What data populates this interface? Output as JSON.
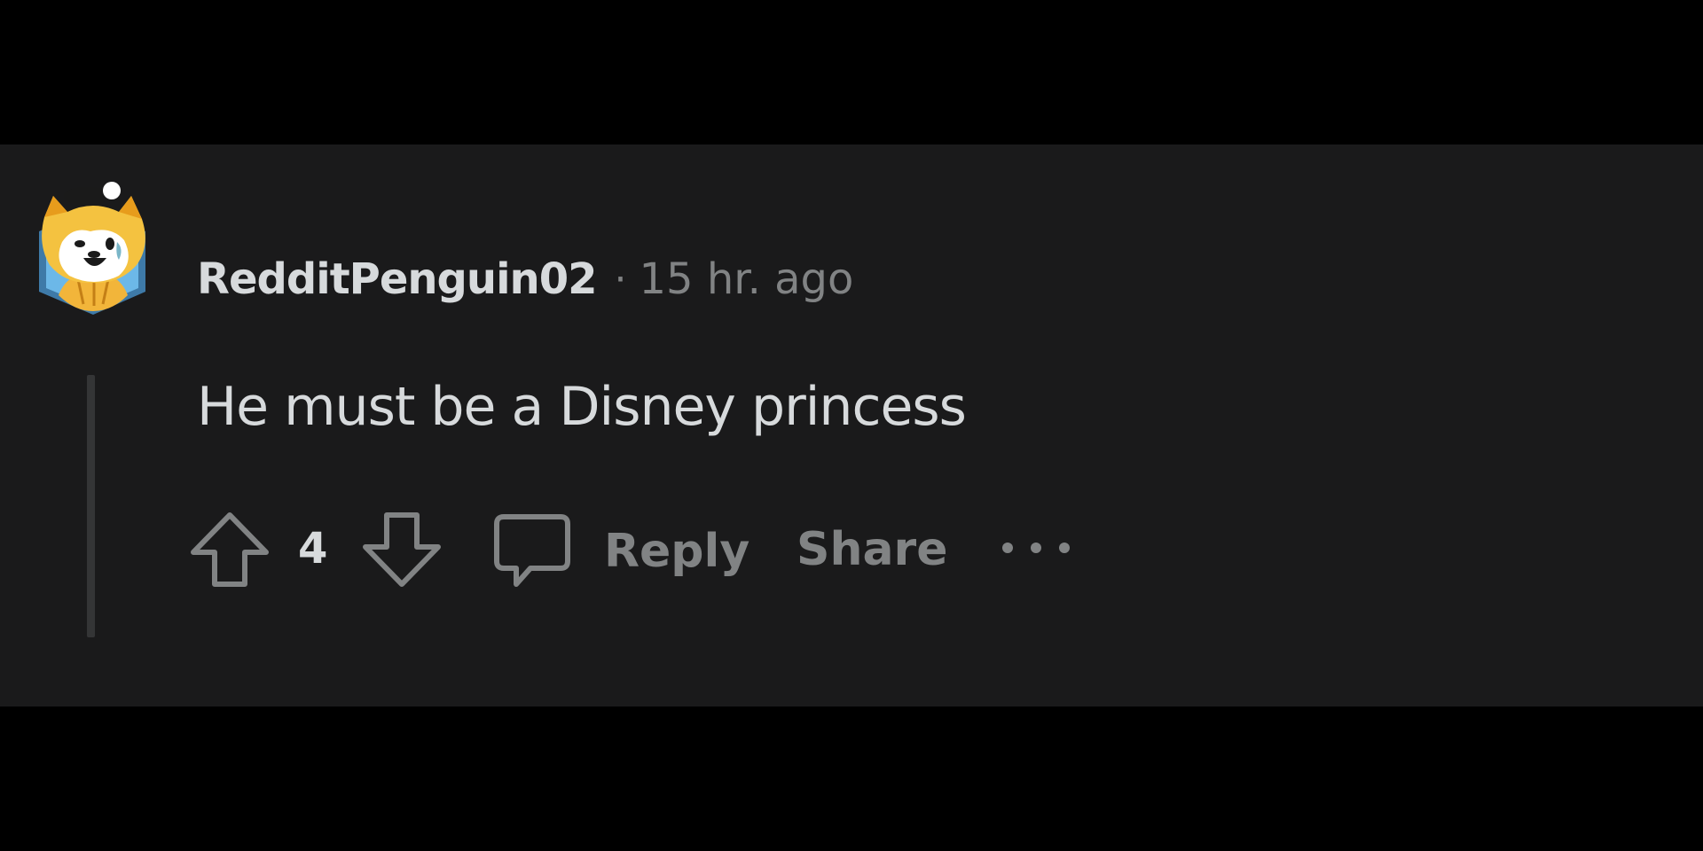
{
  "comment": {
    "username": "RedditPenguin02",
    "separator": "·",
    "timestamp": "15 hr. ago",
    "body": "He must be a Disney princess",
    "avatar_icon": "shiba-inu-avatar-icon",
    "actions": {
      "upvote_icon": "arrow-up-icon",
      "vote_count": "4",
      "downvote_icon": "arrow-down-icon",
      "reply_icon": "speech-bubble-icon",
      "reply_label": "Reply",
      "share_label": "Share",
      "more_icon": "ellipsis-icon"
    }
  },
  "colors": {
    "page_background": "#000000",
    "card_background": "#1a1a1b",
    "primary_text": "#d7dadc",
    "secondary_text": "#818384",
    "thread_line": "#343536"
  }
}
